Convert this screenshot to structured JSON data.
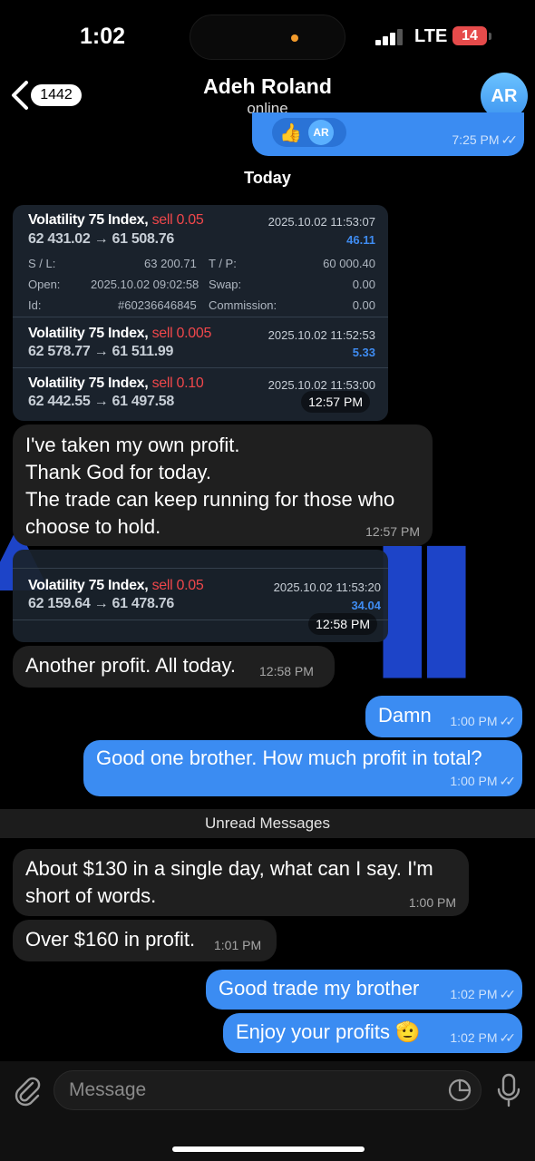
{
  "status_bar": {
    "time": "1:02",
    "network": "LTE",
    "battery": "14"
  },
  "header": {
    "back_count": "1442",
    "contact_name": "Adeh Roland",
    "contact_status": "online",
    "avatar_initials": "AR"
  },
  "top_bubble": {
    "reaction": "👍",
    "reaction_avatar": "AR",
    "time": "7:25 PM"
  },
  "date_separator": "Today",
  "trade_card_1": {
    "trades": [
      {
        "symbol": "Volatility 75 Index,",
        "action": "sell 0.05",
        "prices": "62 431.02 → 61 508.76",
        "date": "2025.10.02 11:53:07",
        "profit": "46.11"
      },
      {
        "symbol": "Volatility 75 Index,",
        "action": "sell 0.005",
        "prices": "62 578.77 → 61 511.99",
        "date": "2025.10.02 11:52:53",
        "profit": "5.33"
      },
      {
        "symbol": "Volatility 75 Index,",
        "action": "sell 0.10",
        "prices": "62 442.55 → 61 497.58",
        "date": "2025.10.02 11:53:00",
        "profit": ""
      }
    ],
    "details": {
      "sl_label": "S / L:",
      "sl_value": "63 200.71",
      "tp_label": "T / P:",
      "tp_value": "60 000.40",
      "open_label": "Open:",
      "open_value": "2025.10.02 09:02:58",
      "swap_label": "Swap:",
      "swap_value": "0.00",
      "id_label": "Id:",
      "id_value": "#60236646845",
      "commission_label": "Commission:",
      "commission_value": "0.00"
    },
    "time": "12:57 PM"
  },
  "msg_profit_taken": {
    "lines": [
      "I've taken my own profit.",
      "Thank God for today.",
      "The trade can keep running for those who",
      "choose to hold."
    ],
    "time": "12:57 PM"
  },
  "trade_card_2": {
    "symbol": "Volatility 75 Index,",
    "action": "sell 0.05",
    "prices": "62 159.64 → 61 478.76",
    "date": "2025.10.02 11:53:20",
    "profit": "34.04",
    "time": "12:58 PM"
  },
  "msg_another_profit": {
    "text": "Another profit. All today.",
    "time": "12:58 PM"
  },
  "msg_damn": {
    "text": "Damn",
    "time": "1:00 PM"
  },
  "msg_good_one": {
    "text": "Good one brother. How much profit in total?",
    "time": "1:00 PM"
  },
  "unread_separator": "Unread Messages",
  "msg_130": {
    "lines": [
      "About $130 in a single day, what can I say. I'm",
      "short of words."
    ],
    "time": "1:00 PM"
  },
  "msg_160": {
    "text": "Over $160 in profit.",
    "time": "1:01 PM"
  },
  "msg_good_trade": {
    "text": "Good trade my brother",
    "time": "1:02 PM"
  },
  "msg_enjoy": {
    "text": "Enjoy your profits",
    "emoji": "🫡",
    "time": "1:02 PM"
  },
  "input": {
    "placeholder": "Message"
  },
  "colors": {
    "outgoing": "#3b8cf2",
    "incoming": "#1f1f1f",
    "sell": "#f0474b",
    "profit": "#3f8cf1",
    "card_bg": "#1a222c"
  },
  "icons": [
    "back-chevron-icon",
    "signal-icon",
    "battery-icon",
    "double-check-icon",
    "paperclip-icon",
    "sticker-icon",
    "microphone-icon"
  ]
}
